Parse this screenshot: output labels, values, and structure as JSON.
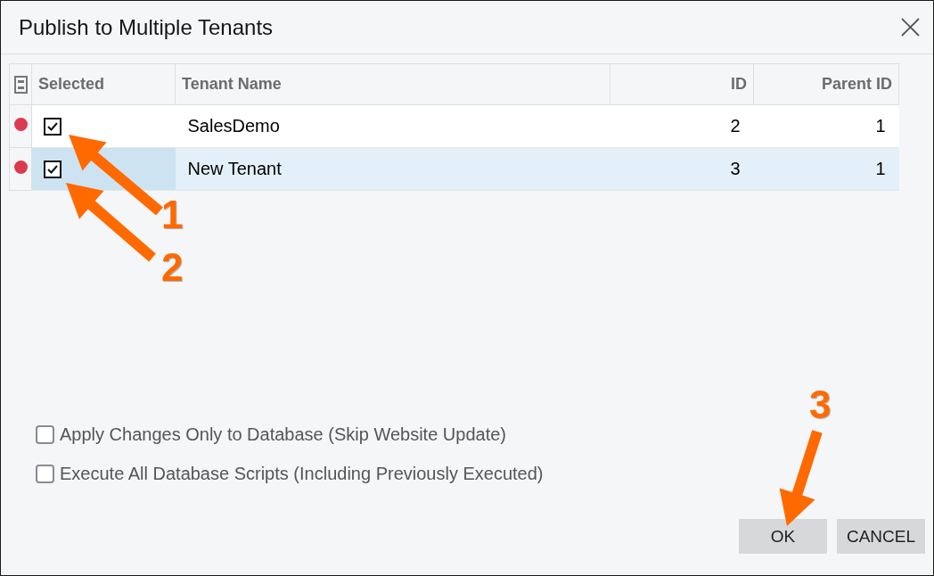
{
  "dialog": {
    "title": "Publish to Multiple Tenants"
  },
  "table": {
    "columns": [
      {
        "label": "Selected",
        "kind": "checkbox"
      },
      {
        "label": "Tenant Name",
        "kind": "text"
      },
      {
        "label": "ID",
        "kind": "number"
      },
      {
        "label": "Parent ID",
        "kind": "number"
      }
    ],
    "rows": [
      {
        "selected": false,
        "color": "#dc3a4e",
        "cells": [
          {
            "checked": true
          },
          {
            "text": "SalesDemo"
          },
          {
            "text": "2"
          },
          {
            "text": "1"
          }
        ]
      },
      {
        "selected": true,
        "color": "#dc3a4e",
        "cells": [
          {
            "checked": true
          },
          {
            "text": "New Tenant"
          },
          {
            "text": "3"
          },
          {
            "text": "1"
          }
        ]
      }
    ]
  },
  "options": [
    {
      "label": "Apply Changes Only to Database (Skip Website Update)",
      "checked": false
    },
    {
      "label": "Execute All Database Scripts (Including Previously Executed)",
      "checked": false
    }
  ],
  "buttons": [
    "OK",
    "CANCEL"
  ],
  "annotations": [
    {
      "label": "1"
    },
    {
      "label": "2"
    },
    {
      "label": "3"
    }
  ]
}
